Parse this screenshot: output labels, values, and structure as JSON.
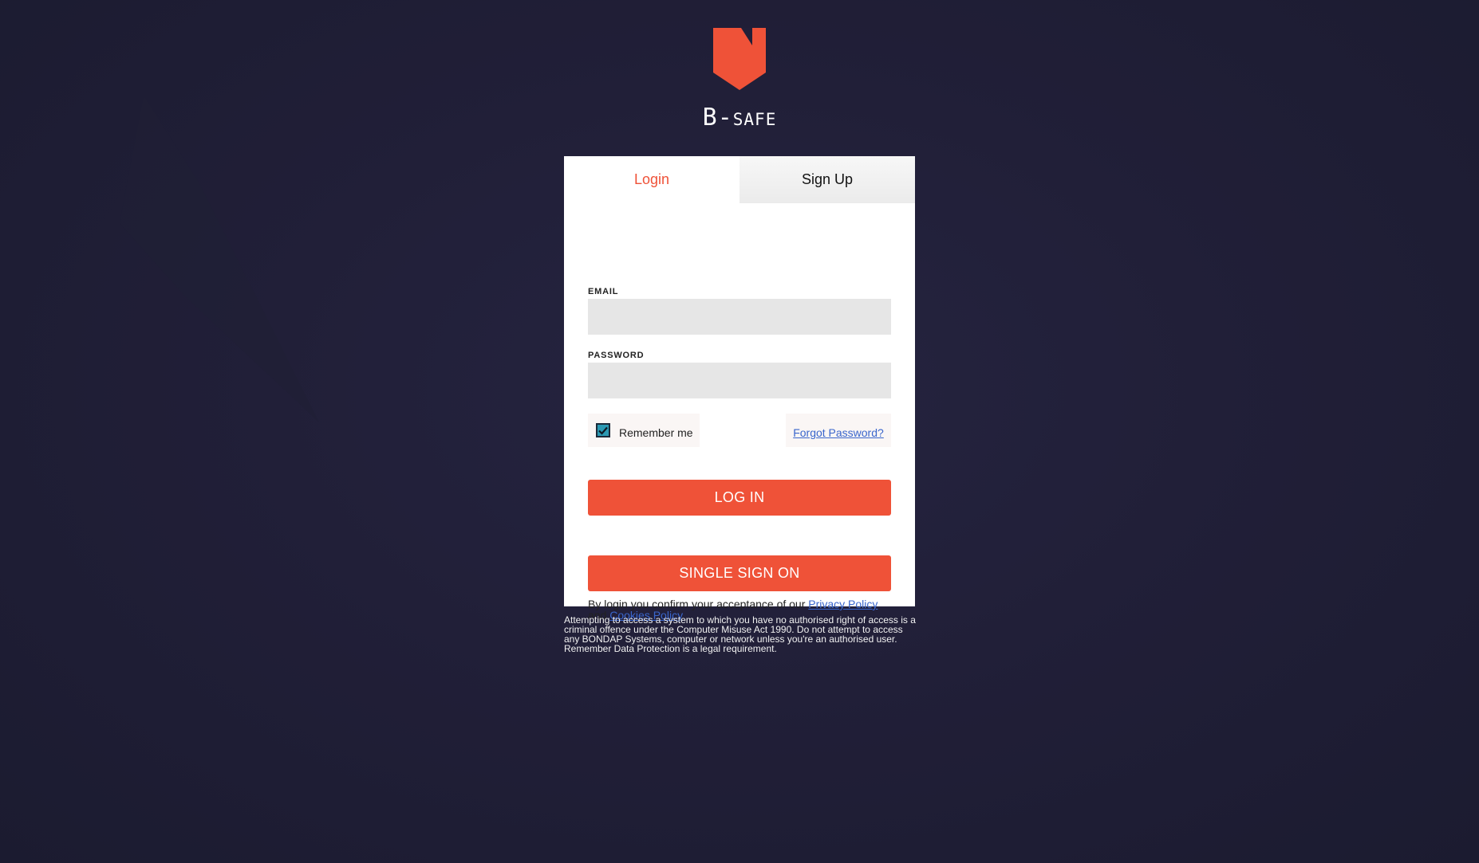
{
  "brand": {
    "name": "B-safe",
    "logo_icon": "shield-logo-icon",
    "accent_color": "#ef5238"
  },
  "tabs": [
    {
      "label": "Login",
      "active": true
    },
    {
      "label": "Sign Up",
      "active": false
    }
  ],
  "form": {
    "email_label": "EMAIL",
    "email_value": "",
    "password_label": "PASSWORD",
    "password_value": "",
    "remember_label": "Remember me",
    "remember_checked": true,
    "forgot_label": "Forgot Password?",
    "login_button": "LOG IN",
    "sso_button": "SINGLE SIGN ON"
  },
  "consent": {
    "prefix": "By login you confirm your acceptance of our ",
    "privacy_link": "Privacy Policy",
    "middle": "and ",
    "cookies_link": "Cookies Policy"
  },
  "disclaimer": "Attempting to access a system to which you have no authorised right of access is a criminal offence under the Computer Misuse Act 1990. Do not attempt to access any BONDAP Systems, computer or network unless you're an authorised user. Remember Data Protection is a legal requirement."
}
